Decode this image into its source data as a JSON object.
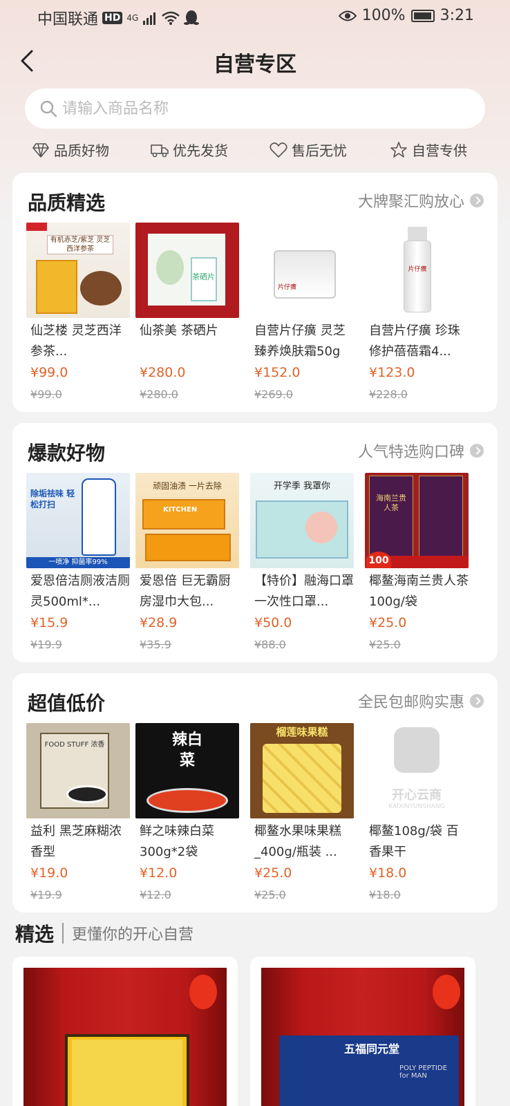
{
  "status_bar": {
    "carrier": "中国联通",
    "hd": "HD",
    "network": "4G",
    "battery": "100%",
    "time": "3:21"
  },
  "nav": {
    "title": "自营专区"
  },
  "search": {
    "placeholder": "请输入商品名称"
  },
  "features": [
    "品质好物",
    "优先发货",
    "售后无忧",
    "自营专供"
  ],
  "sections": [
    {
      "title": "品质精选",
      "subtitle": "大牌聚汇购放心",
      "products": [
        {
          "name": "仙芝楼 灵芝西洋参茶...",
          "price": "¥99.0",
          "original": "¥99.0"
        },
        {
          "name": "仙茶美 茶硒片",
          "price": "¥280.0",
          "original": "¥280.0"
        },
        {
          "name": "自营片仔癀 灵芝臻养焕肤霜50g",
          "price": "¥152.0",
          "original": "¥269.0"
        },
        {
          "name": "自营片仔癀 珍珠修护蓓蓓霜4...",
          "price": "¥123.0",
          "original": "¥228.0"
        }
      ]
    },
    {
      "title": "爆款好物",
      "subtitle": "人气特选购口碑",
      "products": [
        {
          "name": "爱恩倍洁厕液洁厕灵500ml*...",
          "price": "¥15.9",
          "original": "¥19.9"
        },
        {
          "name": "爱恩倍 巨无霸厨房湿巾大包...",
          "price": "¥28.9",
          "original": "¥35.9"
        },
        {
          "name": "【特价】融海口罩 一次性口罩...",
          "price": "¥50.0",
          "original": "¥88.0"
        },
        {
          "name": "椰鳌海南兰贵人茶100g/袋",
          "price": "¥25.0",
          "original": "¥25.0"
        }
      ]
    },
    {
      "title": "超值低价",
      "subtitle": "全民包邮购实惠",
      "products": [
        {
          "name": "益利 黑芝麻糊浓香型",
          "price": "¥19.0",
          "original": "¥19.9"
        },
        {
          "name": "鲜之味辣白菜300g*2袋",
          "price": "¥12.0",
          "original": "¥12.0"
        },
        {
          "name": "椰鳌水果味果糕_400g/瓶装 ...",
          "price": "¥25.0",
          "original": "¥25.0"
        },
        {
          "name": "椰鳌108g/袋 百香果干",
          "price": "¥18.0",
          "original": "¥18.0"
        }
      ]
    }
  ],
  "thumb_text": {
    "s0p0": "有机赤芝/紫芝 灵芝西洋参茶",
    "s0p1": "茶硒片",
    "s0p2": "片仔癀",
    "s0p3": "片仔癀",
    "s1p0": "除垢祛味 轻松打扫",
    "s1p0b": "一喷净 抑菌率99%",
    "s1p1": "顽固油渍 一片去除",
    "s1p1b": "KITCHEN",
    "s1p2": "开学季 我罩你",
    "s1p3": "海南兰贵人茶",
    "s1p3b": "100",
    "s2p0": "FOOD STUFF 浓香",
    "s2p1": "辣白菜",
    "s2p2": "榴莲味果糕",
    "s2p3a": "开心云商",
    "s2p3b": "KAIXINYUNSHANG"
  },
  "featured": {
    "title": "精选",
    "subtitle": "更懂你的开心自营",
    "card2_brand": "五福同元堂",
    "card2_sub": "POLY PEPTIDE for MAN"
  }
}
